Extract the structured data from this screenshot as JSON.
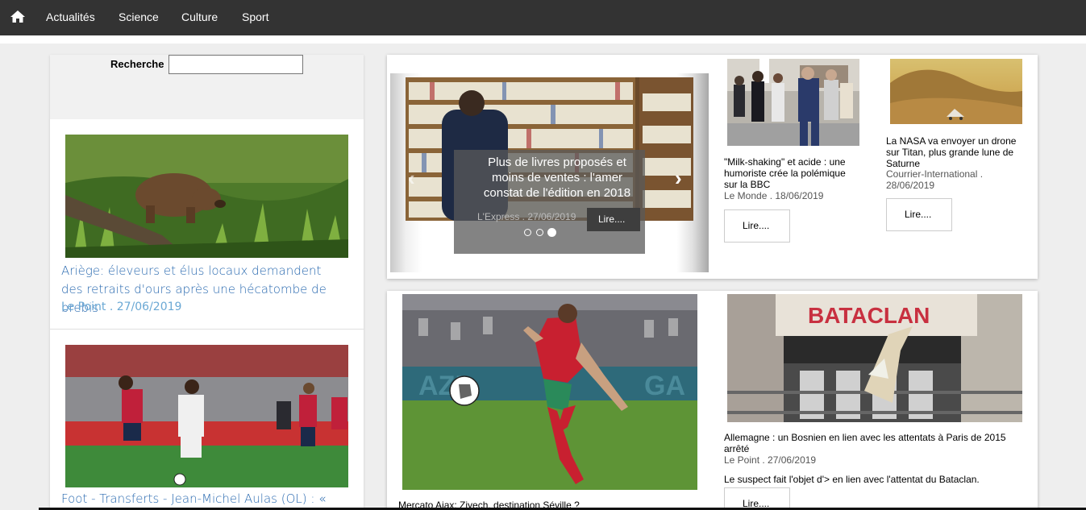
{
  "nav": {
    "items": [
      "Actualités",
      "Science",
      "Culture",
      "Sport"
    ]
  },
  "search": {
    "label": "Recherche",
    "value": ""
  },
  "left_articles": [
    {
      "title": "Ariège: éleveurs et élus locaux demandent des retraits d'ours après une hécatombe de brebis",
      "meta": "Le Point . 27/06/2019"
    },
    {
      "title": "Foot - Transferts - Jean-Michel Aulas (OL) : « Avec"
    }
  ],
  "carousel": {
    "title": "Plus de livres proposés et moins de ventes : l'amer constat de l'édition en 2018",
    "meta": "L'Express . 27/06/2019",
    "button": "Lire....",
    "prev": "‹",
    "next": "›"
  },
  "top_cards": [
    {
      "title": "\"Milk-shaking\" et acide : une humoriste crée la polémique sur la BBC",
      "meta": "Le Monde . 18/06/2019",
      "button": "Lire...."
    },
    {
      "title": "La NASA va envoyer un drone sur Titan, plus grande lune de Saturne",
      "meta": "Courrier-International . 28/06/2019",
      "button": "Lire...."
    }
  ],
  "bottom_cards": [
    {
      "title": "Mercato Ajax: Ziyech, destination Séville ?"
    },
    {
      "sign_text": "BATACLAN",
      "title": "Allemagne : un Bosnien en lien avec les attentats à Paris de 2015 arrêté",
      "meta": "Le Point . 27/06/2019",
      "description": "Le suspect fait l'objet d'> en lien avec l'attentat du Bataclan.",
      "button": "Lire...."
    }
  ],
  "colors": {
    "nav_bg": "#333333",
    "link_blue": "#2a6ab0",
    "meta_blue": "#6aa8d4"
  }
}
